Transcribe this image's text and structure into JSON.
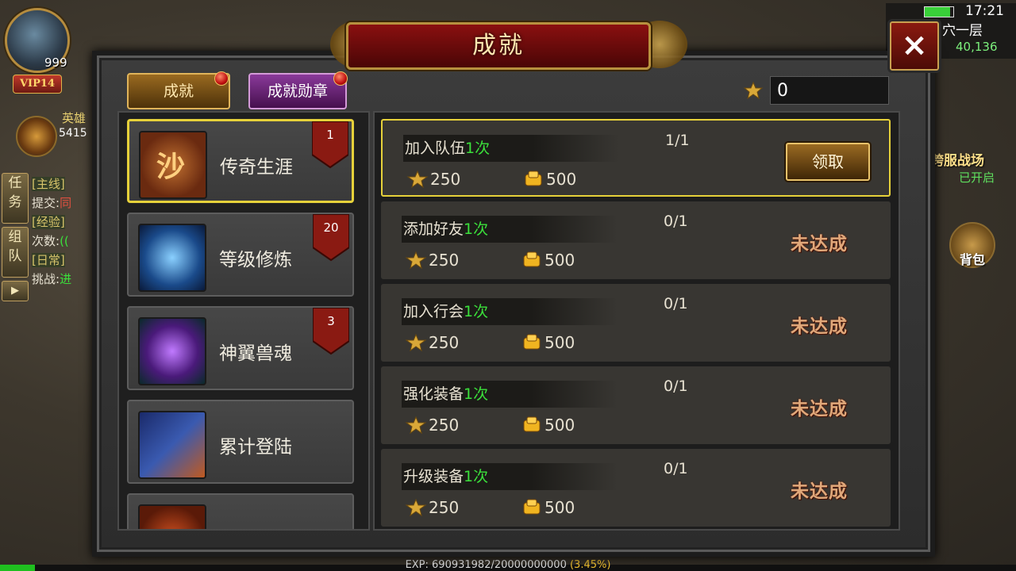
{
  "hud": {
    "level": "999",
    "vip": "VIP14",
    "hero_name": "英雄",
    "hero_number": "5415",
    "side_tabs": [
      "任务",
      "组队"
    ],
    "quests": [
      {
        "tag": "[主线]",
        "text": "提交:",
        "extra": "同"
      },
      {
        "tag": "[经验]",
        "text": "次数:",
        "extra": "(("
      },
      {
        "tag": "[日常]",
        "text": "挑战:",
        "extra": "进"
      }
    ],
    "time": "17:21",
    "map_name": "洞穴一层",
    "coord": "40,136",
    "cross_server": "跨服战场",
    "cross_server_status": "已开启",
    "bag": "背包",
    "exp_text": "EXP: 690931982/20000000000",
    "exp_pct": "(3.45%)",
    "exp_fraction": 0.0345
  },
  "dialog": {
    "title": "成就",
    "close": "×",
    "tabs": [
      "成就",
      "成就勋章"
    ],
    "coins": "0"
  },
  "categories": [
    {
      "label": "传奇生涯",
      "badge": "1"
    },
    {
      "label": "等级修炼",
      "badge": "20"
    },
    {
      "label": "神翼兽魂",
      "badge": "3"
    },
    {
      "label": "累计登陆",
      "badge": ""
    }
  ],
  "achievements": [
    {
      "name": "加入队伍",
      "count": "1次",
      "progress": "1/1",
      "reward1": "250",
      "reward2": "500",
      "status": "claim",
      "claim_label": "领取"
    },
    {
      "name": "添加好友",
      "count": "1次",
      "progress": "0/1",
      "reward1": "250",
      "reward2": "500",
      "status": "未达成"
    },
    {
      "name": "加入行会",
      "count": "1次",
      "progress": "0/1",
      "reward1": "250",
      "reward2": "500",
      "status": "未达成"
    },
    {
      "name": "强化装备",
      "count": "1次",
      "progress": "0/1",
      "reward1": "250",
      "reward2": "500",
      "status": "未达成"
    },
    {
      "name": "升级装备",
      "count": "1次",
      "progress": "0/1",
      "reward1": "250",
      "reward2": "500",
      "status": "未达成"
    }
  ],
  "colors": {
    "accent_gold": "#e6d13a",
    "count_green": "#3be03b",
    "title_red": "#8a1010"
  }
}
